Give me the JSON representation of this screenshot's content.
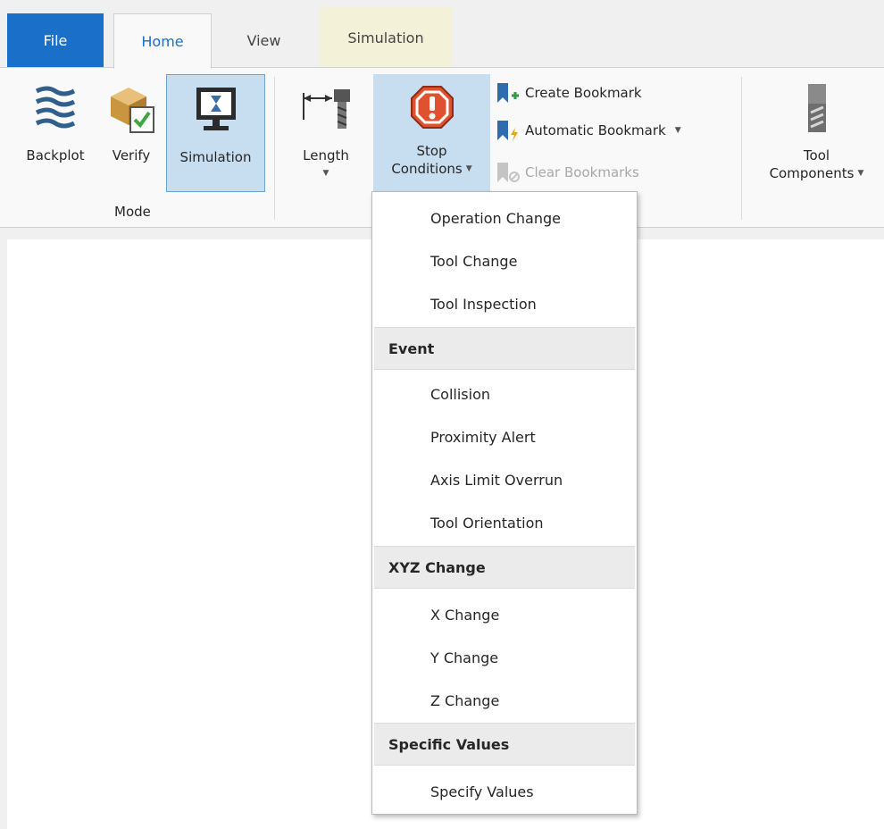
{
  "tabs": {
    "file": "File",
    "home": "Home",
    "view": "View",
    "simulation": "Simulation"
  },
  "ribbon": {
    "mode": {
      "group_label": "Mode",
      "backplot": "Backplot",
      "verify": "Verify",
      "simulation": "Simulation"
    },
    "length": {
      "label": "Length"
    },
    "stop_conditions": {
      "line1": "Stop",
      "line2": "Conditions"
    },
    "bookmarks": {
      "create": "Create Bookmark",
      "automatic": "Automatic Bookmark",
      "clear": "Clear Bookmarks"
    },
    "tool_components": {
      "line1": "Tool",
      "line2": "Components"
    }
  },
  "stop_menu": {
    "items_top": [
      "Operation Change",
      "Tool Change",
      "Tool Inspection"
    ],
    "event_header": "Event",
    "event_items": [
      "Collision",
      "Proximity Alert",
      "Axis Limit Overrun",
      "Tool Orientation"
    ],
    "xyz_header": "XYZ Change",
    "xyz_items": [
      "X Change",
      "Y Change",
      "Z Change"
    ],
    "values_header": "Specific Values",
    "values_items": [
      "Specify Values"
    ]
  },
  "colors": {
    "accent": "#1a6fc9",
    "selected_bg": "#c7def1",
    "stop_icon": "#e0522f"
  }
}
